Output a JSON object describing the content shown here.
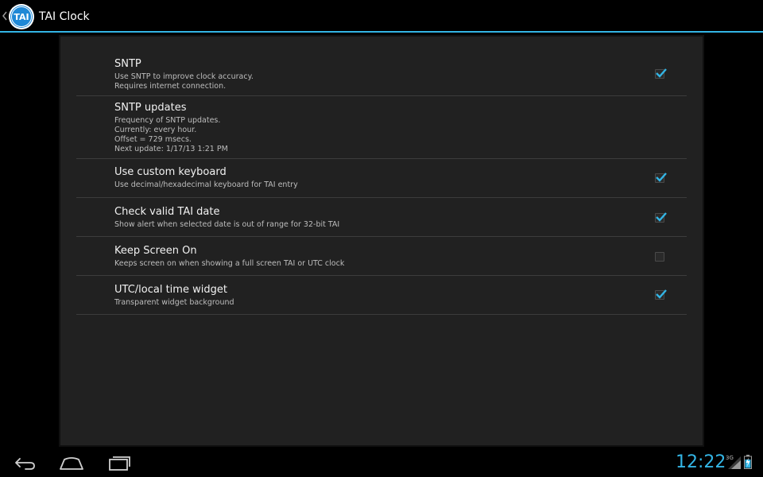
{
  "app": {
    "title": "TAI Clock",
    "icon_text": "TAI",
    "accent_color": "#33b5e5"
  },
  "preferences": [
    {
      "title": "SNTP",
      "summary": "Use SNTP to improve clock accuracy.\nRequires internet connection.",
      "checkbox": true,
      "checked": true
    },
    {
      "title": "SNTP updates",
      "summary": "Frequency of SNTP updates.\nCurrently: every hour.\nOffset = 729 msecs.\nNext update: 1/17/13 1:21 PM",
      "checkbox": false,
      "checked": false
    },
    {
      "title": "Use custom keyboard",
      "summary": "Use decimal/hexadecimal keyboard for TAI entry",
      "checkbox": true,
      "checked": true
    },
    {
      "title": "Check valid TAI date",
      "summary": "Show alert when selected date is out of range for 32-bit TAI",
      "checkbox": true,
      "checked": true
    },
    {
      "title": "Keep Screen On",
      "summary": "Keeps screen on when showing a full screen TAI or UTC clock",
      "checkbox": true,
      "checked": false
    },
    {
      "title": "UTC/local time widget",
      "summary": "Transparent widget background",
      "checkbox": true,
      "checked": true
    }
  ],
  "status_bar": {
    "time": "12:22",
    "network": "3G"
  },
  "icons": {
    "up": "chevron-left-icon",
    "back": "back-arrow-icon",
    "home": "home-icon",
    "recents": "recent-apps-icon",
    "signal": "signal-strength-icon",
    "battery": "battery-charging-icon"
  }
}
